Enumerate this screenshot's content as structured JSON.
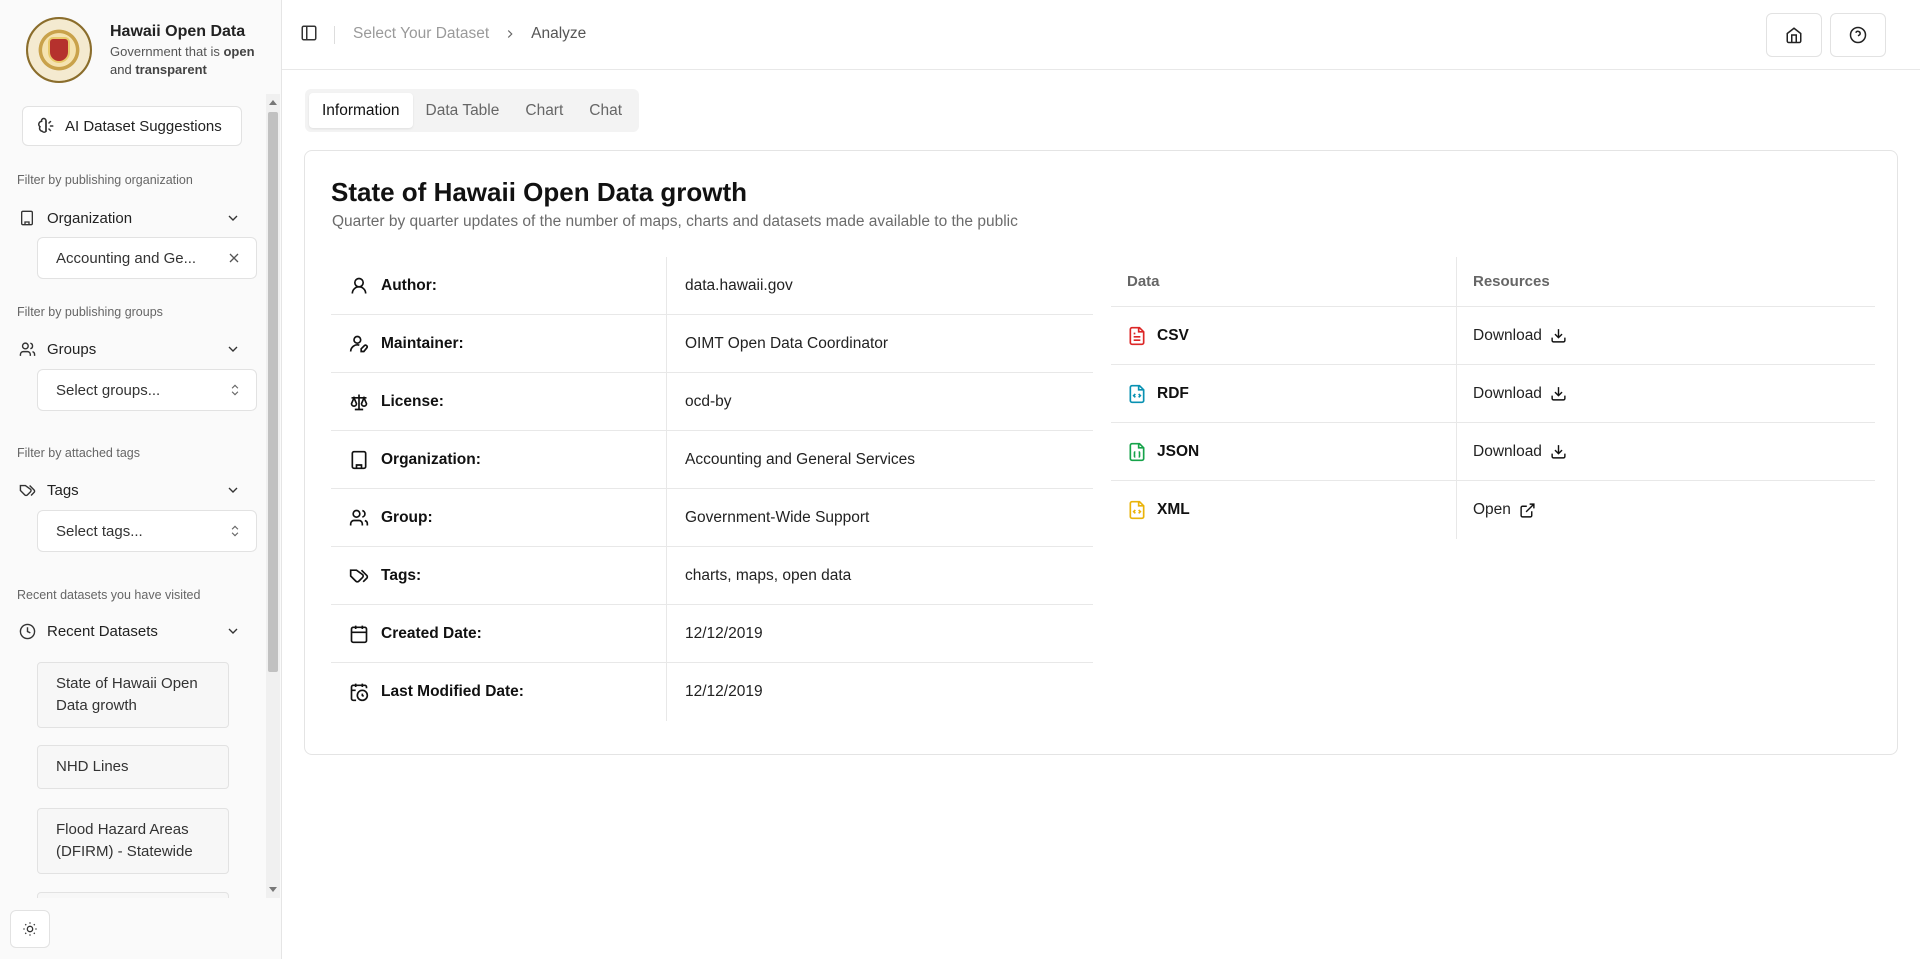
{
  "brand": {
    "title": "Hawaii Open Data",
    "subtitle_pre": "Government that is",
    "subtitle_b1": "open",
    "subtitle_and": "and",
    "subtitle_b2": "transparent"
  },
  "sidebar": {
    "ai_button_label": "AI Dataset Suggestions",
    "org_caption": "Filter by publishing organization",
    "org_label": "Organization",
    "org_selected": "Accounting and Ge...",
    "groups_caption": "Filter by publishing groups",
    "groups_label": "Groups",
    "groups_placeholder": "Select groups...",
    "tags_caption": "Filter by attached tags",
    "tags_label": "Tags",
    "tags_placeholder": "Select tags...",
    "recent_caption": "Recent datasets you have visited",
    "recent_label": "Recent Datasets",
    "recent_items": [
      "State of Hawaii Open Data growth",
      "NHD Lines",
      "Flood Hazard Areas (DFIRM) - Statewide"
    ]
  },
  "header": {
    "breadcrumb_1": "Select Your Dataset",
    "breadcrumb_2": "Analyze"
  },
  "tabs": [
    "Information",
    "Data Table",
    "Chart",
    "Chat"
  ],
  "dataset": {
    "title": "State of Hawaii Open Data growth",
    "description": "Quarter by quarter updates of the number of maps, charts and datasets made available to the public",
    "meta": [
      {
        "label": "Author:",
        "value": "data.hawaii.gov",
        "icon": "user-icon"
      },
      {
        "label": "Maintainer:",
        "value": "OIMT Open Data Coordinator",
        "icon": "user-pen-icon"
      },
      {
        "label": "License:",
        "value": "ocd-by",
        "icon": "scale-icon"
      },
      {
        "label": "Organization:",
        "value": "Accounting and General Services",
        "icon": "building-icon"
      },
      {
        "label": "Group:",
        "value": "Government-Wide Support",
        "icon": "users-icon"
      },
      {
        "label": "Tags:",
        "value": "charts, maps, open data",
        "icon": "tags-icon"
      },
      {
        "label": "Created Date:",
        "value": "12/12/2019",
        "icon": "calendar-icon"
      },
      {
        "label": "Last Modified Date:",
        "value": "12/12/2019",
        "icon": "calendar-clock-icon"
      }
    ]
  },
  "resources": {
    "col_data": "Data",
    "col_resources": "Resources",
    "rows": [
      {
        "format": "CSV",
        "action": "Download",
        "color": "#dc2626",
        "icon": "download-icon"
      },
      {
        "format": "RDF",
        "action": "Download",
        "color": "#0891b2",
        "icon": "download-icon"
      },
      {
        "format": "JSON",
        "action": "Download",
        "color": "#16a34a",
        "icon": "download-icon"
      },
      {
        "format": "XML",
        "action": "Open",
        "color": "#eab308",
        "icon": "external-link-icon"
      }
    ]
  }
}
